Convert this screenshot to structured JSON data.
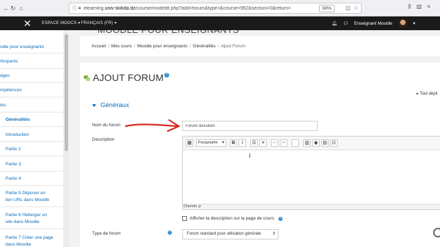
{
  "browser": {
    "url_domain": "univ-skikda.dz",
    "url_prefix": "elearning.",
    "url_path": "/course/modedit.php?add=forum&type=&course=962&section=0&return=",
    "zoom": "90%"
  },
  "navbar": {
    "brand_menu": "ESPACE MOOCS",
    "language_menu": "FRANÇAIS (FR)",
    "user_name": "Enseignant Moodle",
    "course_header": "MOODLE POUR ENSEIGNANTS"
  },
  "sidebar": {
    "items": [
      {
        "label": "odle pour enseignants"
      },
      {
        "label": "rticipants"
      },
      {
        "label": "dges"
      },
      {
        "label": "mpétences"
      },
      {
        "label": "tes"
      },
      {
        "label": "Généralités"
      },
      {
        "label": "Introduction"
      },
      {
        "label": "Partie 2"
      },
      {
        "label": "Partie 3"
      },
      {
        "label": "Partie 4"
      },
      {
        "label": "Partie 5 Déposer un"
      },
      {
        "label": "lien URL dans Moodle"
      },
      {
        "label": "Partie 6 Heberger un"
      },
      {
        "label": "site dans Moodle"
      },
      {
        "label": "Partie 7 Créer une page"
      },
      {
        "label": "dans Moodle"
      }
    ]
  },
  "breadcrumb": {
    "home": "Accueil",
    "my_courses": "Mes cours",
    "course": "Moodle pour enseignants",
    "section": "Généralités",
    "current": "Ajout Forum"
  },
  "page": {
    "title": "AJOUT FORUM",
    "help_glyph": "?",
    "expand_all": "Tout dépli",
    "section_general": "Généraux"
  },
  "form": {
    "forum_name_label": "Nom du forum",
    "forum_name_value": "Forum discution",
    "description_label": "Description",
    "paragraph_select": "Paragraphe",
    "bold": "B",
    "italic": "I",
    "editor_path": "Chemin: p",
    "show_description_label": "Afficher la description sur la page de cours",
    "forum_type_label": "Type de forum",
    "forum_type_value": "Forum standard pour utilisation générale"
  }
}
